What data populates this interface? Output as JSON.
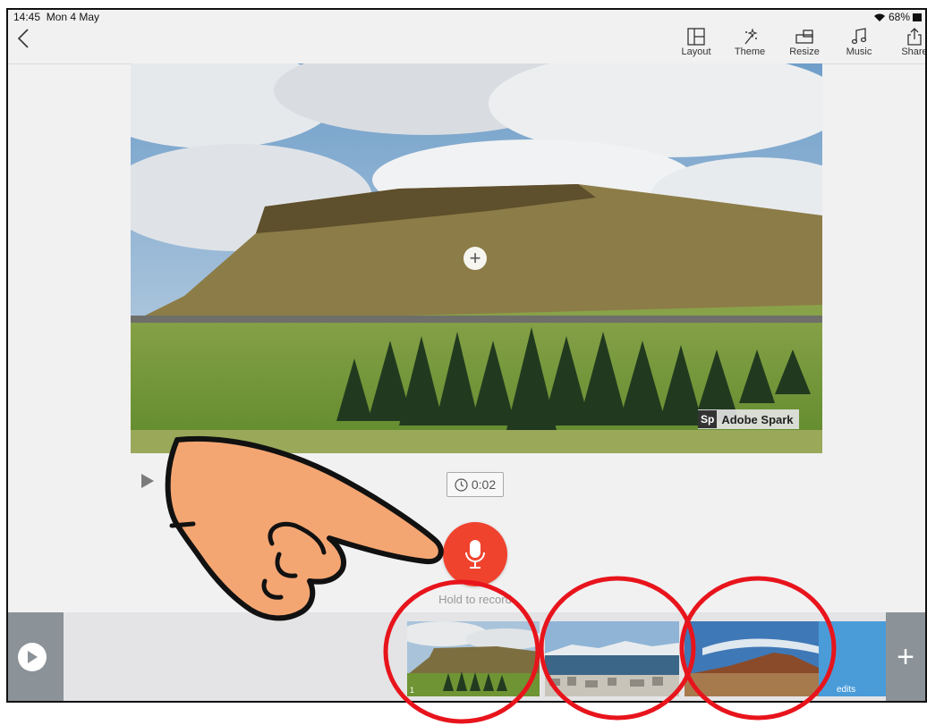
{
  "status": {
    "time": "14:45",
    "date": "Mon 4 May",
    "battery": "68%"
  },
  "toolbar": {
    "layout_label": "Layout",
    "theme_label": "Theme",
    "resize_label": "Resize",
    "music_label": "Music",
    "share_label": "Share"
  },
  "canvas": {
    "watermark_badge": "Sp",
    "watermark_text": "Adobe Spark"
  },
  "controls": {
    "duration": "0:02",
    "record_hint": "Hold to record"
  },
  "timeline": {
    "slides": [
      {
        "number": "1"
      }
    ],
    "credits_label": "Credits",
    "credits_visible": "edits",
    "add_symbol": "+"
  },
  "colors": {
    "accent": "#f0432e",
    "annotation": "#e8141c",
    "timeline_bg": "#e4e4e6"
  }
}
